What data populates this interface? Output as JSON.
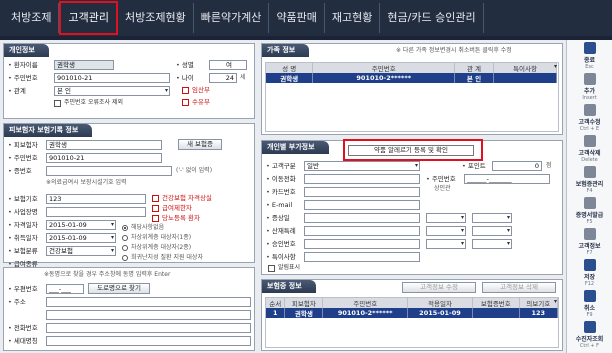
{
  "nav": {
    "tabs": [
      {
        "label": "처방조제"
      },
      {
        "label": "고객관리"
      },
      {
        "label": "처방조제현황"
      },
      {
        "label": "빠른약가계산"
      },
      {
        "label": "약품판매"
      },
      {
        "label": "재고현황"
      },
      {
        "label": "현금/카드 승인관리"
      }
    ]
  },
  "personal": {
    "title": "개인정보",
    "name_label": "환자이름",
    "name": "권학생",
    "gender_label": "성별",
    "gender": "여",
    "rrn_label": "주민번호",
    "rrn": "901010-21",
    "age_label": "나이",
    "age": "24",
    "age_unit": "세",
    "rel_label": "관계",
    "rel": "본 인",
    "pregnant": "임산부",
    "nursing": "수유부",
    "rrn_check": "주민번호 오류조사 제외"
  },
  "insured": {
    "title": "피보험자 보험기록 정보",
    "name_label": "피보험자",
    "name": "권학생",
    "new_btn": "새 보험증",
    "rrn_label": "주민번호",
    "rrn": "901010-21",
    "cert_label": "증번호",
    "cert_hint": "('-' 없이 입력)",
    "cert_note": "※의료급여시 보장시설기호 입력",
    "code_label": "보험기호",
    "code": "123",
    "biz_label": "사업장명",
    "acq_label": "자격일자",
    "acq": "2015-01-09",
    "issue_label": "취득일자",
    "issue": "2015-01-09",
    "type_label": "보험분류",
    "type": "건강보험",
    "medaid_label": "급여종류",
    "chk1": "건강보험 자격상실",
    "chk2": "급여제한자",
    "chk3": "당뇨등록 환자",
    "radio1": "해당사항없음",
    "radio2": "차상위계층 대상자(1종)",
    "radio3": "차상위계층 대상자(2종)",
    "radio4": "희귀난치성 질환 지원 대상자"
  },
  "address": {
    "note": "※동명으로 찾을 경우 주소창에 동명 입력후 Enter",
    "zip_label": "우편번호",
    "zip": "___-___",
    "find_btn": "도로명으로 찾기",
    "addr_label": "주소",
    "phone_label": "전화번호",
    "mobile_label": "핸드폰",
    "household_label": "세대명칭"
  },
  "family": {
    "title": "가족 정보",
    "note": "※ 다른 가족 정보변경시 취소버튼 클릭후 수정",
    "cols": [
      "성 명",
      "주민번호",
      "관 계",
      "특이사항"
    ],
    "rows": [
      {
        "name": "권학생",
        "rrn": "901010-2******",
        "rel": "본 인",
        "memo": ""
      }
    ]
  },
  "extra": {
    "title": "개인별 부가정보",
    "alert_btn": "약품 알레르기 등록 및 확인",
    "cust_type_label": "고객구분",
    "cust_type": "일반",
    "point_label": "포인트",
    "point": "0",
    "point_unit": "점",
    "email_label": "이동전화",
    "card_label": "카드번호",
    "emailaddr_label": "E-mail",
    "memo1_label": "증상일",
    "memo2_label": "산재특례",
    "memo3_label": "승인번호",
    "memo4_label": "특이사항",
    "rrn2_label": "주민번호",
    "rrn2": "______-_______",
    "name2_label": "상인관",
    "smsok": "알림표시"
  },
  "insurance": {
    "title": "보험증 정보",
    "edit_btn": "고객정보 수정",
    "del_btn": "고객정보 삭제",
    "cols": [
      "순서",
      "피보험자",
      "주민번호",
      "적용일자",
      "보험증번호",
      "의보기호"
    ],
    "rows": [
      {
        "no": "1",
        "name": "권학생",
        "rrn": "901010-2******",
        "date": "2015-01-09",
        "cert": "",
        "code": "123"
      }
    ]
  },
  "rightbar": {
    "buttons": [
      {
        "label": "종료",
        "sc": "Esc",
        "color": "#2b4f8e"
      },
      {
        "label": "추가",
        "sc": "Insert",
        "color": "#7d8797"
      },
      {
        "label": "고객수정",
        "sc": "Ctrl + E",
        "color": "#7d8797"
      },
      {
        "label": "고객삭제",
        "sc": "Delete",
        "color": "#7d8797"
      },
      {
        "label": "보험증관리",
        "sc": "F4",
        "color": "#7d8797"
      },
      {
        "label": "증명서발급",
        "sc": "F5",
        "color": "#7d8797"
      },
      {
        "label": "고객정보",
        "sc": "F7",
        "color": "#7d8797"
      },
      {
        "label": "저장",
        "sc": "F12",
        "color": "#2b4f8e"
      },
      {
        "label": "취소",
        "sc": "F9",
        "color": "#2b4f8e"
      },
      {
        "label": "수진자조회",
        "sc": "Ctrl + F",
        "color": "#2b4f8e"
      }
    ]
  }
}
